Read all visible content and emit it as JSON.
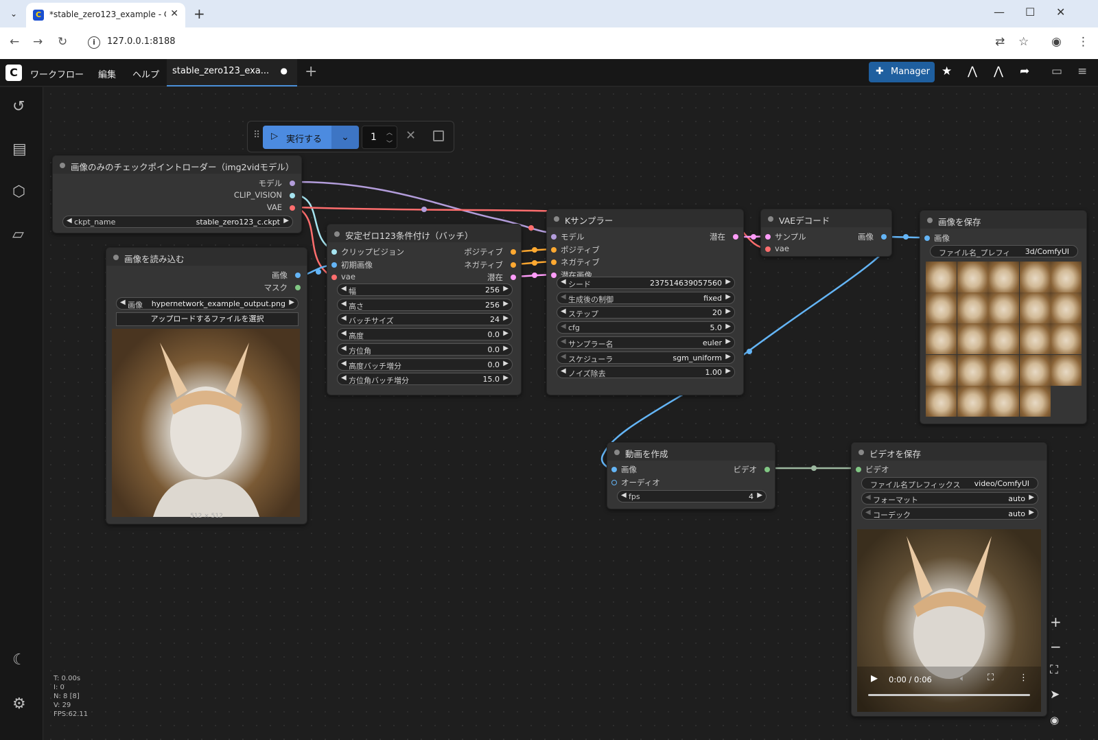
{
  "browser": {
    "tab_title": "*stable_zero123_example - Con",
    "url": "127.0.0.1:8188"
  },
  "app": {
    "menus": [
      "ワークフロー",
      "編集",
      "ヘルプ"
    ],
    "workflow_tab": "stable_zero123_exa...",
    "workflow_modified_dot": "●",
    "manager_label": "Manager"
  },
  "run": {
    "label": "実行する",
    "count": "1"
  },
  "nodes": {
    "checkpoint": {
      "title": "画像のみのチェックポイントローダー（img2vidモデル）",
      "outputs": [
        "モデル",
        "CLIP_VISION",
        "VAE"
      ],
      "widget_label": "ckpt_name",
      "widget_value": "stable_zero123_c.ckpt"
    },
    "load_image": {
      "title": "画像を読み込む",
      "outputs": [
        "画像",
        "マスク"
      ],
      "widget_label": "画像",
      "widget_value": "hypernetwork_example_output.png",
      "upload_label": "アップロードするファイルを選択",
      "size_label": "512 × 512"
    },
    "zero123": {
      "title": "安定ゼロ123条件付け（バッチ）",
      "inputs": [
        "クリップビジョン",
        "初期画像",
        "vae"
      ],
      "outputs": [
        "ポジティブ",
        "ネガティブ",
        "潜在"
      ],
      "widgets": [
        {
          "label": "幅",
          "value": "256"
        },
        {
          "label": "高さ",
          "value": "256"
        },
        {
          "label": "バッチサイズ",
          "value": "24"
        },
        {
          "label": "高度",
          "value": "0.0"
        },
        {
          "label": "方位角",
          "value": "0.0"
        },
        {
          "label": "高度バッチ増分",
          "value": "0.0"
        },
        {
          "label": "方位角バッチ増分",
          "value": "15.0"
        }
      ]
    },
    "ksampler": {
      "title": "Kサンプラー",
      "inputs": [
        "モデル",
        "ポジティブ",
        "ネガティブ",
        "潜在画像"
      ],
      "output": "潜在",
      "widgets": [
        {
          "label": "シード",
          "value": "237514639057560"
        },
        {
          "label": "生成後の制御",
          "value": "fixed"
        },
        {
          "label": "ステップ",
          "value": "20"
        },
        {
          "label": "cfg",
          "value": "5.0"
        },
        {
          "label": "サンプラー名",
          "value": "euler"
        },
        {
          "label": "スケジューラ",
          "value": "sgm_uniform"
        },
        {
          "label": "ノイズ除去",
          "value": "1.00"
        }
      ]
    },
    "vae_decode": {
      "title": "VAEデコード",
      "inputs": [
        "サンプル",
        "vae"
      ],
      "output": "画像"
    },
    "save_image": {
      "title": "画像を保存",
      "input": "画像",
      "prefix_label": "ファイル名_プレフィ",
      "prefix_value": "3d/ComfyUI"
    },
    "create_video": {
      "title": "動画を作成",
      "inputs": [
        "画像",
        "オーディオ"
      ],
      "output": "ビデオ",
      "fps_label": "fps",
      "fps_value": "4"
    },
    "save_video": {
      "title": "ビデオを保存",
      "input": "ビデオ",
      "widgets": [
        {
          "label": "ファイル名プレフィックス",
          "value": "video/ComfyUI"
        },
        {
          "label": "フォーマット",
          "value": "auto"
        },
        {
          "label": "コーデック",
          "value": "auto"
        }
      ],
      "time": "0:00 / 0:06"
    }
  },
  "stats": [
    "T: 0.00s",
    "I: 0",
    "N: 8 [8]",
    "V: 29",
    "FPS:62.11"
  ],
  "colors": {
    "accent": "#4a90d9",
    "wire_model": "#b39ddb",
    "wire_vae": "#ff6e6e",
    "wire_conditioning": "#ffa931",
    "wire_latent": "#ff9cf9",
    "wire_image": "#64b5f6",
    "wire_video": "#9db8a0"
  }
}
